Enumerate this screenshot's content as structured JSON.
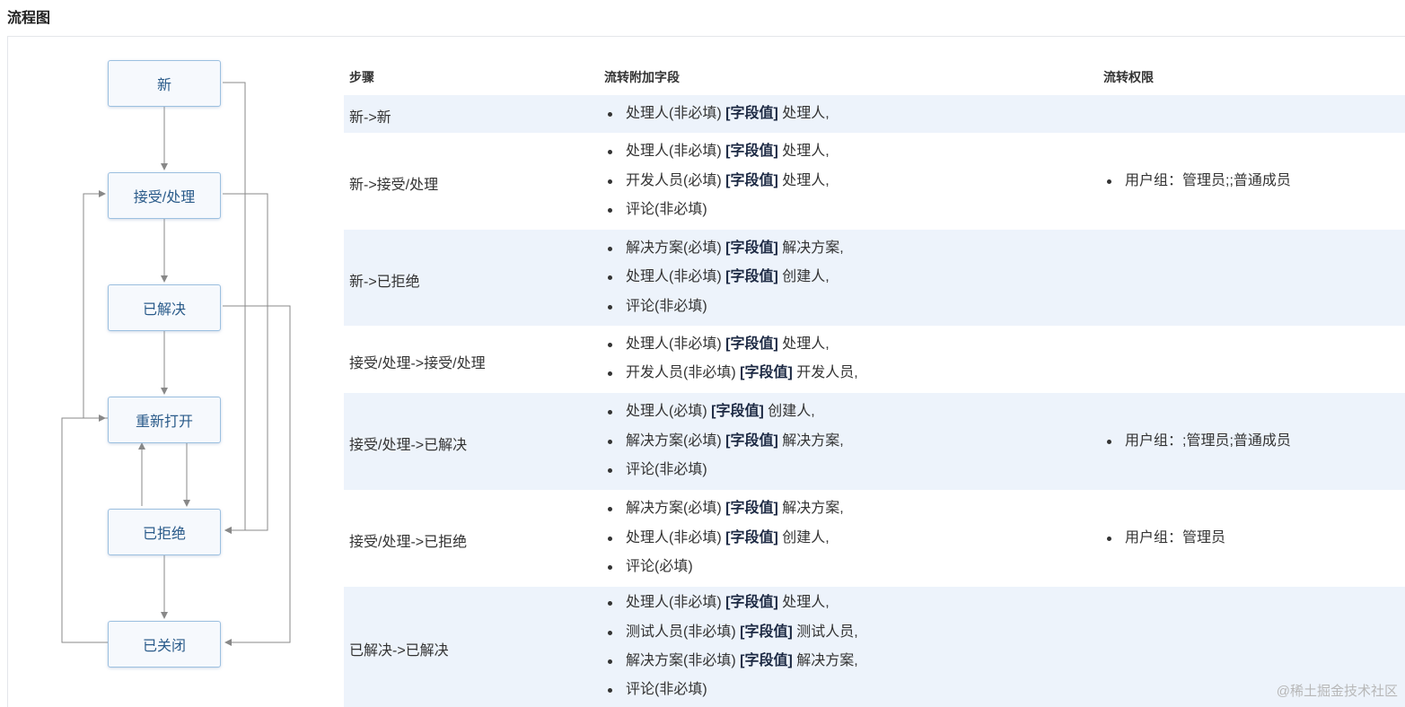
{
  "section_title": "流程图",
  "flow": {
    "nodes": [
      "新",
      "接受/处理",
      "已解决",
      "重新打开",
      "已拒绝",
      "已关闭"
    ]
  },
  "table": {
    "headers": {
      "step": "步骤",
      "fields": "流转附加字段",
      "perms": "流转权限"
    },
    "tag": "[字段值]",
    "rows": [
      {
        "step": "新->新",
        "fields": [
          {
            "label": "处理人(非必填)",
            "value": "处理人,"
          }
        ],
        "perms": []
      },
      {
        "step": "新->接受/处理",
        "fields": [
          {
            "label": "处理人(非必填)",
            "value": "处理人,"
          },
          {
            "label": "开发人员(必填)",
            "value": "处理人,"
          },
          {
            "label": "评论(非必填)",
            "value": ""
          }
        ],
        "perms": [
          "用户组：管理员;;普通成员"
        ]
      },
      {
        "step": "新->已拒绝",
        "fields": [
          {
            "label": "解决方案(必填)",
            "value": "解决方案,"
          },
          {
            "label": "处理人(非必填)",
            "value": "创建人,"
          },
          {
            "label": "评论(非必填)",
            "value": ""
          }
        ],
        "perms": []
      },
      {
        "step": "接受/处理->接受/处理",
        "fields": [
          {
            "label": "处理人(非必填)",
            "value": "处理人,"
          },
          {
            "label": "开发人员(非必填)",
            "value": "开发人员,"
          }
        ],
        "perms": []
      },
      {
        "step": "接受/处理->已解决",
        "fields": [
          {
            "label": "处理人(必填)",
            "value": "创建人,"
          },
          {
            "label": "解决方案(必填)",
            "value": "解决方案,"
          },
          {
            "label": "评论(非必填)",
            "value": ""
          }
        ],
        "perms": [
          "用户组：;管理员;普通成员"
        ]
      },
      {
        "step": "接受/处理->已拒绝",
        "fields": [
          {
            "label": "解决方案(必填)",
            "value": "解决方案,"
          },
          {
            "label": "处理人(非必填)",
            "value": "创建人,"
          },
          {
            "label": "评论(必填)",
            "value": ""
          }
        ],
        "perms": [
          "用户组：管理员"
        ]
      },
      {
        "step": "已解决->已解决",
        "fields": [
          {
            "label": "处理人(非必填)",
            "value": "处理人,"
          },
          {
            "label": "测试人员(非必填)",
            "value": "测试人员,"
          },
          {
            "label": "解决方案(非必填)",
            "value": "解决方案,"
          },
          {
            "label": "评论(非必填)",
            "value": ""
          }
        ],
        "perms": []
      }
    ]
  },
  "watermark": "@稀土掘金技术社区"
}
